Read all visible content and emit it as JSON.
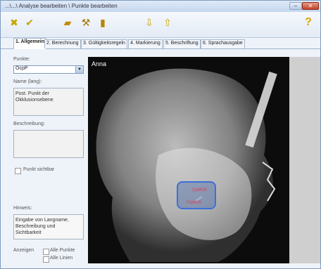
{
  "window": {
    "title": "...\\...\\ Analyse bearbeiten \\ Punkte bearbeiten"
  },
  "toolbar": {
    "tools": [
      {
        "name": "cancel-icon",
        "glyph": "✖",
        "color": "#c9a400"
      },
      {
        "name": "confirm-icon",
        "glyph": "✔",
        "color": "#c9a400"
      },
      {
        "name": "open-folder-icon",
        "glyph": "📂",
        "color": "#c28c00"
      },
      {
        "name": "tools-icon",
        "glyph": "🔨",
        "color": "#a27500"
      },
      {
        "name": "delete-icon",
        "glyph": "🗑",
        "color": "#b58500"
      },
      {
        "name": "move-down-icon",
        "glyph": "⇩",
        "color": "#c9a400"
      },
      {
        "name": "move-up-icon",
        "glyph": "⇧",
        "color": "#c9a400"
      },
      {
        "name": "help-icon",
        "glyph": "?",
        "color": "#d4a800"
      }
    ]
  },
  "tabs": [
    {
      "label": "1. Allgemein",
      "active": true
    },
    {
      "label": "2. Berechnung",
      "active": false
    },
    {
      "label": "3. Gültigkeitsregeln",
      "active": false
    },
    {
      "label": "4. Markierung",
      "active": false
    },
    {
      "label": "5. Beschriftung",
      "active": false
    },
    {
      "label": "6. Sprachausgabe",
      "active": false
    }
  ],
  "form": {
    "points_label": "Punkte:",
    "points_value": "OcpP",
    "name_label": "Name (lang):",
    "name_value": "Post. Punkt der Okklusionsebene",
    "description_label": "Beschreibung:",
    "description_value": "",
    "visible_label": "Punkt sichtbar",
    "hint_label": "Hinweis:",
    "hint_value": "Eingabe von Langname, Beschreibung und Sichtbarkeit",
    "show_label": "Anzeigen",
    "all_points_label": "Alle Punkte",
    "all_lines_label": "Alle Linien"
  },
  "image": {
    "patient_name": "Anna",
    "roi_labels": [
      "CpMOK",
      "FisMUK"
    ],
    "accent_color": "#3d6fd8",
    "label_color": "#e23a54"
  }
}
